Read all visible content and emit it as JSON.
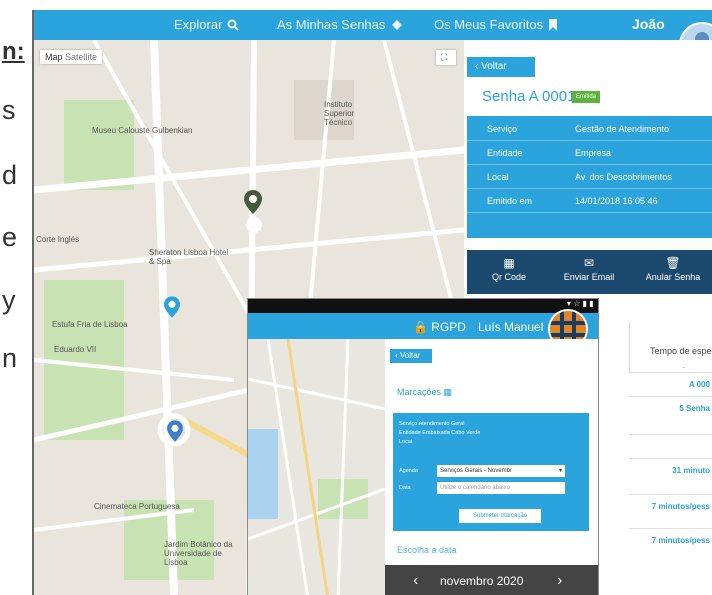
{
  "side_text": [
    "n:",
    "s",
    "d",
    "e",
    "y",
    "n"
  ],
  "topnav": {
    "explorar": "Explorar",
    "senhas": "As Minhas Senhas",
    "favoritos": "Os Meus Favoritos",
    "user": "João"
  },
  "map": {
    "btn_map": "Map",
    "btn_satellite": "Satellite",
    "labels": [
      "Museu Calouste Gulbenkian",
      "Instituto Superior Técnico",
      "Sheraton Lisboa Hotel & Spa",
      "Estufa Fria de Lisboa",
      "Corte Inglés",
      "Cinemateca Portuguesa",
      "Jardim Botânico da Universidade de Lisboa",
      "Eduardo VII"
    ]
  },
  "panel": {
    "voltar": "Voltar",
    "senha": "Senha A 0001",
    "badge": "Emitida",
    "info": [
      {
        "k": "Serviço",
        "v": "Gestão de Atendimento"
      },
      {
        "k": "Entidade",
        "v": "Empresa"
      },
      {
        "k": "Local",
        "v": "Av. dos Descobrimentos"
      },
      {
        "k": "Emitido em",
        "v": "14/01/2018 16:05:46"
      }
    ],
    "actions": [
      {
        "label": "Qr Code",
        "icon": "qr-icon"
      },
      {
        "label": "Enviar Email",
        "icon": "mail-icon"
      },
      {
        "label": "Anular Senha",
        "icon": "trash-icon"
      }
    ],
    "tempo": "Tempo de espera",
    "tempo_val": "-",
    "rows": [
      "A 000",
      "5 Senha",
      "",
      "31 minuto",
      "7 minutos/pess",
      "7 minutos/pess"
    ]
  },
  "phone": {
    "rgpd": "RGPD",
    "user": "Luís Manuel",
    "voltar": "Voltar",
    "marcacoes": "Marcações",
    "servico": "Serviço   Atendimento Geral",
    "entidade": "Entidade Embaixada Cabo Verde",
    "local": "Local",
    "agenda_label": "Agenda",
    "agenda_value": "Serviços Gerais - Novembr",
    "data_label": "Data",
    "data_placeholder": "Utilize o calendário abaixo",
    "submit": "Submeter marcação",
    "escolha": "Escolha a data",
    "month": "novembro 2020"
  }
}
